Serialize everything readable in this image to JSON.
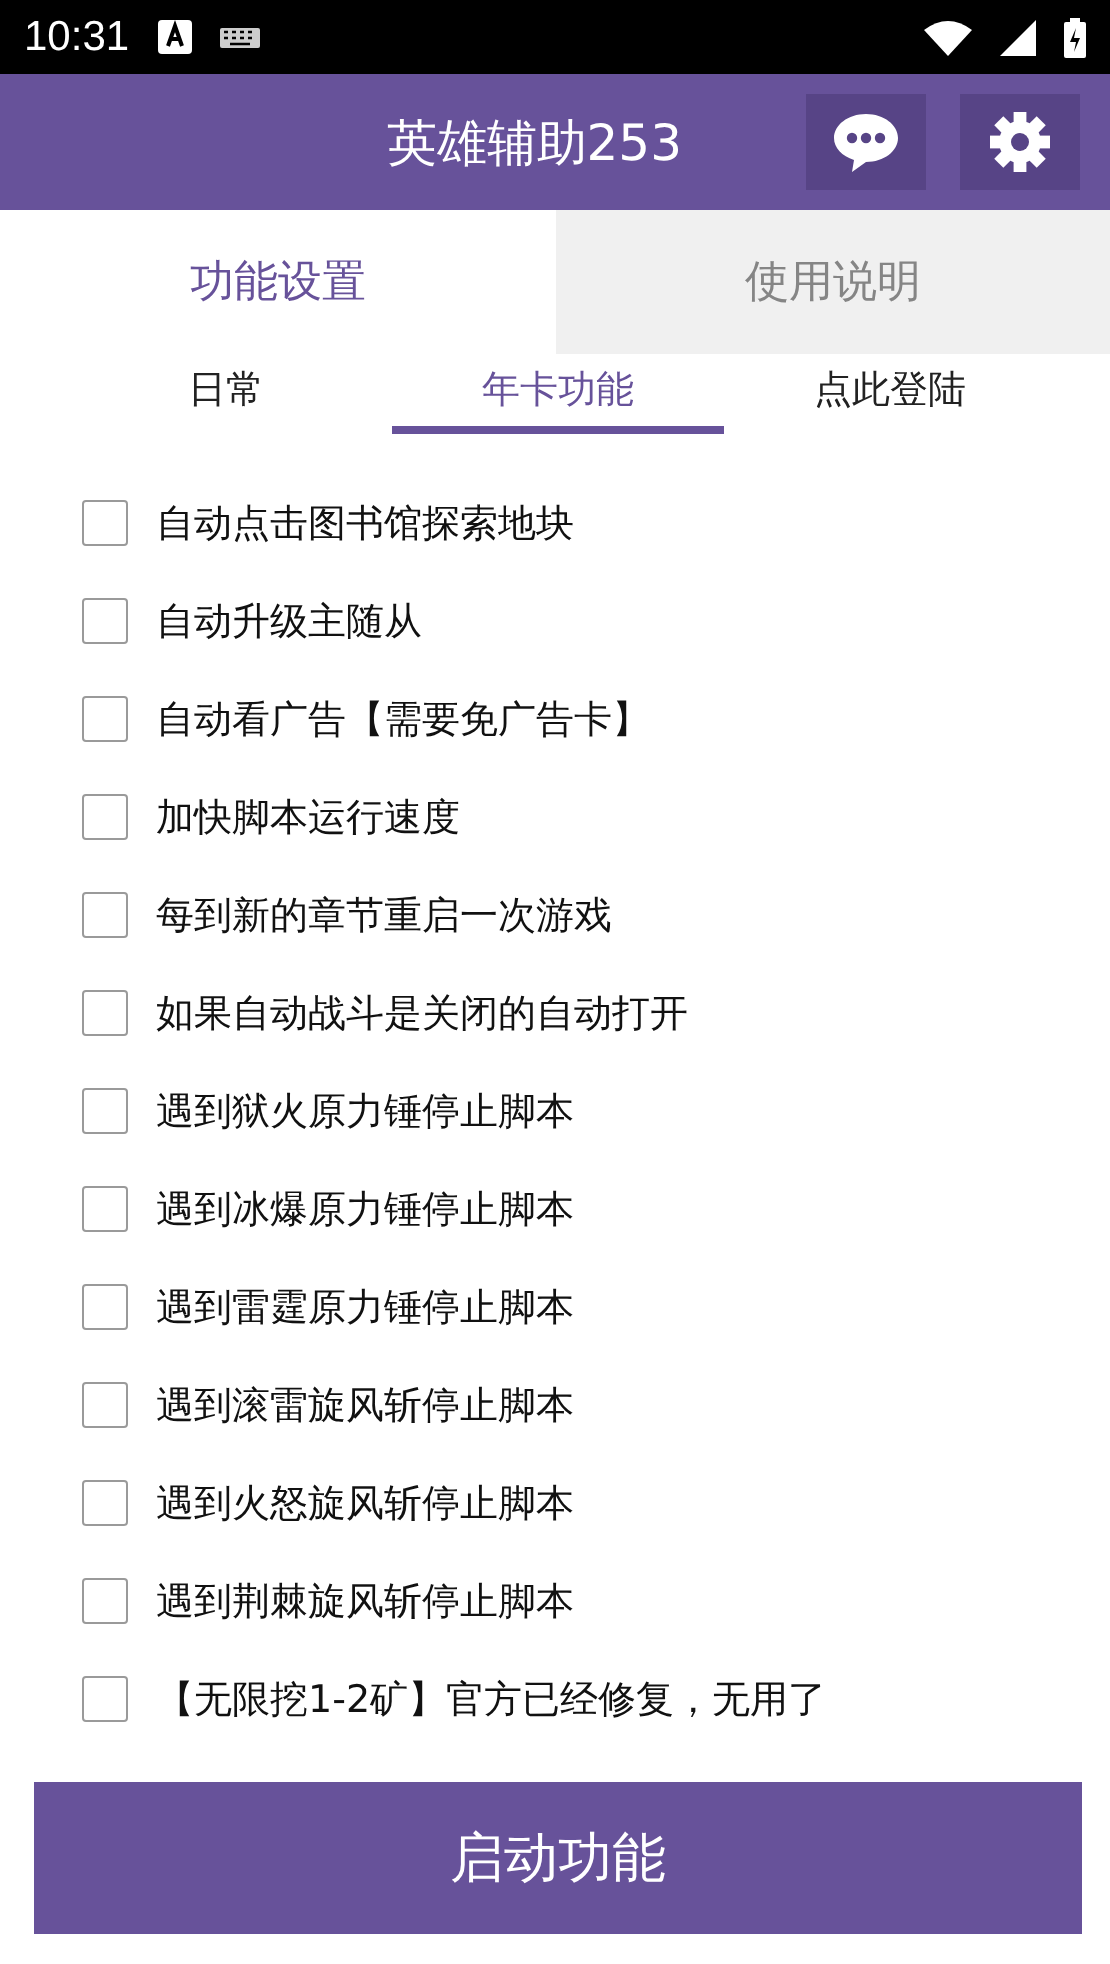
{
  "status_bar": {
    "time": "10:31"
  },
  "header": {
    "title": "英雄辅助253"
  },
  "tabs": [
    {
      "label": "功能设置",
      "selected": true
    },
    {
      "label": "使用说明",
      "selected": false
    }
  ],
  "subtabs": [
    {
      "label": "日常",
      "selected": false
    },
    {
      "label": "年卡功能",
      "selected": true
    },
    {
      "label": "点此登陆",
      "selected": false
    }
  ],
  "options": [
    {
      "label": "自动点击图书馆探索地块",
      "checked": false
    },
    {
      "label": "自动升级主随从",
      "checked": false
    },
    {
      "label": "自动看广告【需要免广告卡】",
      "checked": false
    },
    {
      "label": "加快脚本运行速度",
      "checked": false
    },
    {
      "label": "每到新的章节重启一次游戏",
      "checked": false
    },
    {
      "label": "如果自动战斗是关闭的自动打开",
      "checked": false
    },
    {
      "label": "遇到狱火原力锤停止脚本",
      "checked": false
    },
    {
      "label": "遇到冰爆原力锤停止脚本",
      "checked": false
    },
    {
      "label": "遇到雷霆原力锤停止脚本",
      "checked": false
    },
    {
      "label": "遇到滚雷旋风斩停止脚本",
      "checked": false
    },
    {
      "label": "遇到火怒旋风斩停止脚本",
      "checked": false
    },
    {
      "label": "遇到荆棘旋风斩停止脚本",
      "checked": false
    },
    {
      "label": "【无限挖1-2矿】官方已经修复，无用了",
      "checked": false
    }
  ],
  "start_button": "启动功能"
}
